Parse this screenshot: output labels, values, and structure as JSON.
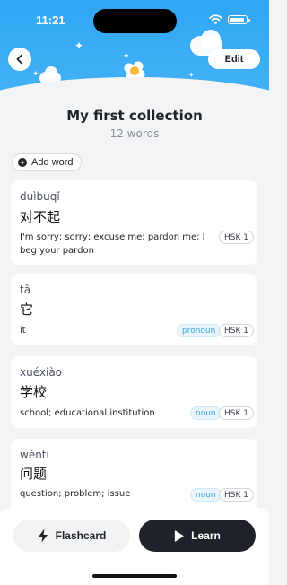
{
  "status_bar": {
    "time": "11:21"
  },
  "header": {
    "edit_label": "Edit",
    "title": "My first collection",
    "word_count": "12 words"
  },
  "actions": {
    "add_word_label": "Add word"
  },
  "words": [
    {
      "pinyin": "duìbuqǐ",
      "hanzi": "对不起",
      "meaning": "I'm sorry; sorry; excuse me; pardon me; I beg your pardon",
      "pos": "",
      "hsk": "HSK 1"
    },
    {
      "pinyin": "tā",
      "hanzi": "它",
      "meaning": "it",
      "pos": "pronoun",
      "hsk": "HSK 1"
    },
    {
      "pinyin": "xuéxiào",
      "hanzi": "学校",
      "meaning": "school; educational institution",
      "pos": "noun",
      "hsk": "HSK 1"
    },
    {
      "pinyin": "wèntí",
      "hanzi": "问题",
      "meaning": "question; problem; issue",
      "pos": "noun",
      "hsk": "HSK 1"
    }
  ],
  "bottom_bar": {
    "flashcard_label": "Flashcard",
    "learn_label": "Learn"
  },
  "colors": {
    "header_blue": "#30a6f3",
    "primary_dark": "#1f2329",
    "tag_blue": "#38a6ea"
  }
}
